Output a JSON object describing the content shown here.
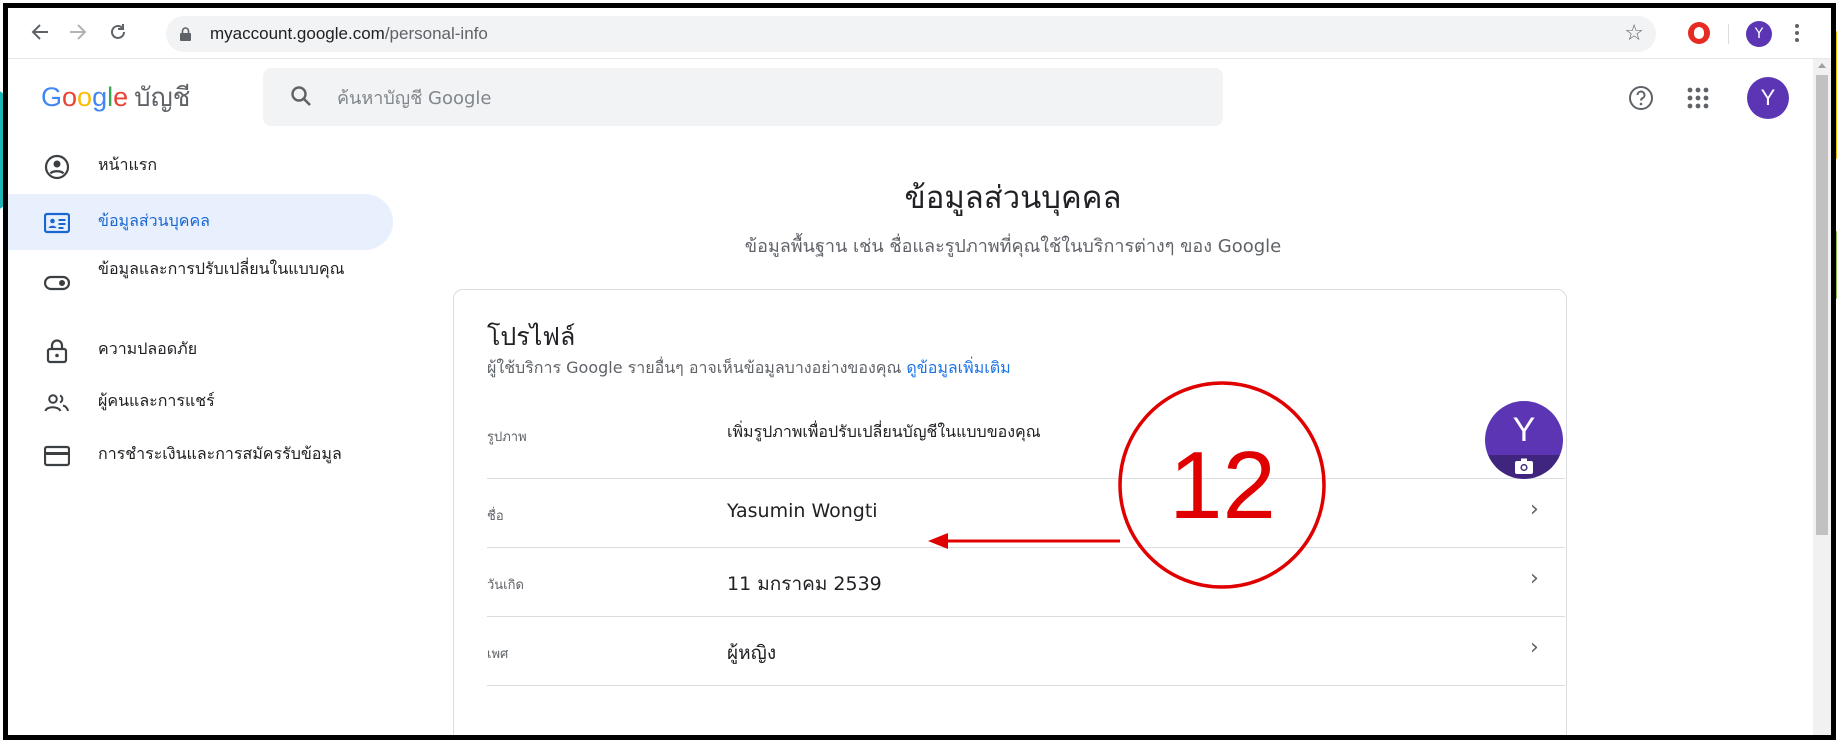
{
  "browser": {
    "url_domain": "myaccount.google.com",
    "url_path": "/personal-info",
    "profile_initial": "Y"
  },
  "header": {
    "logo_letters": [
      "G",
      "o",
      "o",
      "g",
      "l",
      "e"
    ],
    "product_name": "บัญชี",
    "search_placeholder": "ค้นหาบัญชี Google",
    "avatar_initial": "Y"
  },
  "sidebar": {
    "items": [
      {
        "label": "หน้าแรก",
        "icon": "account-circle-icon",
        "active": false
      },
      {
        "label": "ข้อมูลส่วนบุคคล",
        "icon": "id-card-icon",
        "active": true
      },
      {
        "label": "ข้อมูลและการปรับเปลี่ยนในแบบคุณ",
        "icon": "toggle-icon",
        "active": false
      },
      {
        "label": "ความปลอดภัย",
        "icon": "lock-icon",
        "active": false
      },
      {
        "label": "ผู้คนและการแชร์",
        "icon": "people-icon",
        "active": false
      },
      {
        "label": "การชำระเงินและการสมัครรับข้อมูล",
        "icon": "credit-card-icon",
        "active": false
      }
    ]
  },
  "main": {
    "title": "ข้อมูลส่วนบุคคล",
    "subtitle": "ข้อมูลพื้นฐาน เช่น ชื่อและรูปภาพที่คุณใช้ในบริการต่างๆ ของ Google",
    "profile_card": {
      "title": "โปรไฟล์",
      "description": "ผู้ใช้บริการ Google รายอื่นๆ อาจเห็นข้อมูลบางอย่างของคุณ",
      "learn_more": "ดูข้อมูลเพิ่มเติม",
      "rows": [
        {
          "label": "รูปภาพ",
          "value": "เพิ่มรูปภาพเพื่อปรับเปลี่ยนบัญชีในแบบของคุณ",
          "avatar_initial": "Y"
        },
        {
          "label": "ชื่อ",
          "value": "Yasumin Wongti"
        },
        {
          "label": "วันเกิด",
          "value": "11 มกราคม 2539"
        },
        {
          "label": "เพศ",
          "value": "ผู้หญิง"
        }
      ]
    }
  },
  "annotation": {
    "number": "12",
    "color": "#e00000"
  },
  "colors": {
    "accent": "#1a73e8",
    "active_bg": "#e8f0fe",
    "avatar": "#5c35b5"
  }
}
